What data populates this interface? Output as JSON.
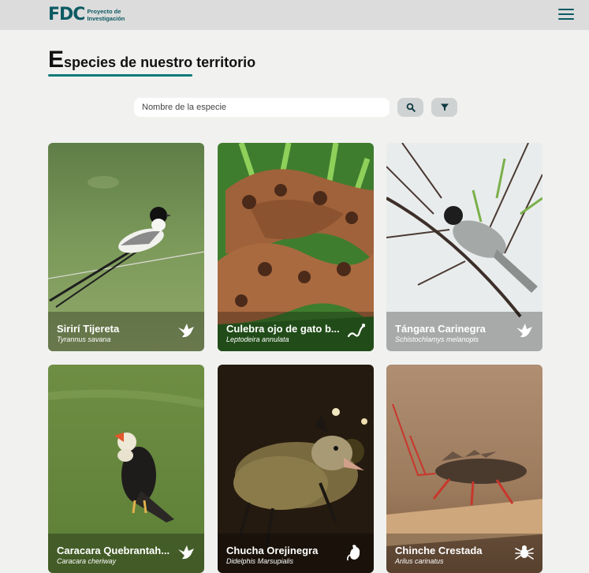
{
  "header": {
    "logo_text": "FDC",
    "logo_sub_line1": "Proyecto de",
    "logo_sub_line2": "Investigación"
  },
  "page": {
    "title_first_letter": "E",
    "title_rest": "species de nuestro territorio"
  },
  "search": {
    "placeholder": "Nombre de la especie"
  },
  "icons": {
    "menu": "hamburger-menu-icon",
    "search": "search-icon",
    "filter": "funnel-filter-icon"
  },
  "colors": {
    "brand": "#0d5a63",
    "accent": "#0e7a78",
    "page_background": "#f1f1f0"
  },
  "species": [
    {
      "common_name": "Sirirí Tijereta",
      "scientific_name": "Tyrannus savana",
      "type_icon": "bird-icon"
    },
    {
      "common_name": "Culebra ojo de gato b...",
      "scientific_name": "Leptodeira annulata",
      "type_icon": "snake-icon"
    },
    {
      "common_name": "Tángara Carinegra",
      "scientific_name": "Schistochlamys melanopis",
      "type_icon": "bird-icon"
    },
    {
      "common_name": "Caracara Quebrantah...",
      "scientific_name": "Caracara cheriway",
      "type_icon": "bird-icon"
    },
    {
      "common_name": "Chucha Orejinegra",
      "scientific_name": "Didelphis Marsupialis",
      "type_icon": "mammal-icon"
    },
    {
      "common_name": "Chinche Crestada",
      "scientific_name": "Arilus carinatus",
      "type_icon": "insect-icon"
    }
  ]
}
